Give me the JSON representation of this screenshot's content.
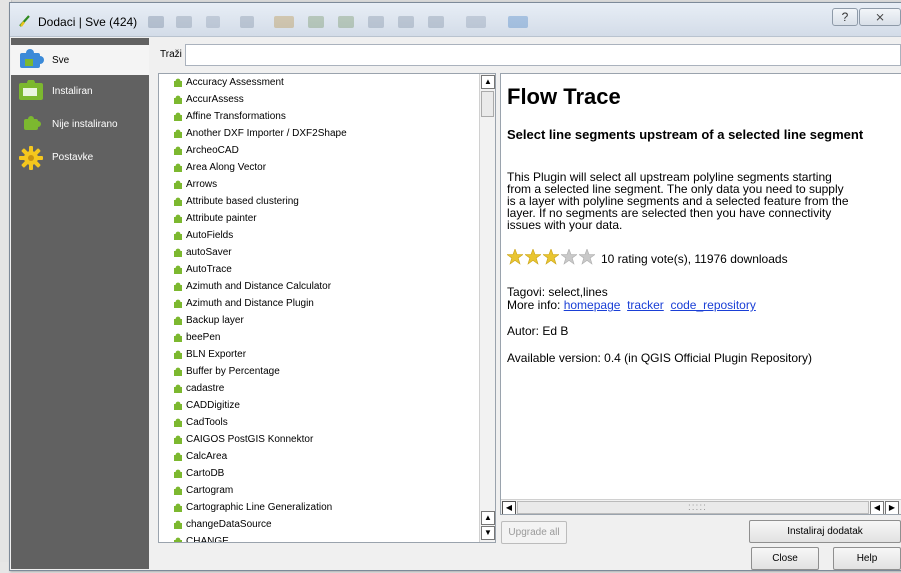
{
  "window": {
    "title": "Dodaci | Sve (424)",
    "controls": {
      "help": "?",
      "close": "⨯"
    }
  },
  "sidebar": {
    "items": [
      {
        "label": "Sve",
        "icon": "puzzle-blue-icon",
        "active": true
      },
      {
        "label": "Instaliran",
        "icon": "puzzle-green-icon",
        "active": false
      },
      {
        "label": "Nije instalirano",
        "icon": "puzzle-green-small-icon",
        "active": false
      },
      {
        "label": "Postavke",
        "icon": "gear-sun-icon",
        "active": false
      }
    ]
  },
  "search": {
    "label": "Traži",
    "value": ""
  },
  "plugin_list": {
    "items": [
      "Accuracy Assessment",
      "AccurAssess",
      "Affine Transformations",
      "Another DXF Importer / DXF2Shape",
      "ArcheoCAD",
      "Area Along Vector",
      "Arrows",
      "Attribute based clustering",
      "Attribute painter",
      "AutoFields",
      "autoSaver",
      "AutoTrace",
      "Azimuth and Distance Calculator",
      "Azimuth and Distance Plugin",
      "Backup layer",
      "beePen",
      "BLN Exporter",
      "Buffer by Percentage",
      "cadastre",
      "CADDigitize",
      "CadTools",
      "CAIGOS PostGIS Konnektor",
      "CalcArea",
      "CartoDB",
      "Cartogram",
      "Cartographic Line Generalization",
      "changeDataSource",
      "CHANGE"
    ]
  },
  "details": {
    "title": "Flow Trace",
    "subtitle": "Select line segments upstream of a selected line segment",
    "description_lines": [
      "This Plugin will select all upstream polyline segments starting",
      "from a selected line segment. The only data you need to supply",
      "is a layer with polyline segments and a selected feature from the",
      "layer. If no segments are selected then you have connectivity",
      "issues with your data."
    ],
    "rating_stars": 3,
    "rating_max": 5,
    "rating_text": "10 rating vote(s), 11976 downloads",
    "tags": "Tagovi: select,lines",
    "more_info_label": "More info:",
    "links": [
      "homepage",
      "tracker",
      "code_repository"
    ],
    "author": "Autor: Ed B",
    "version": "Available version: 0.4 (in QGIS Official Plugin Repository)"
  },
  "buttons": {
    "upgrade_all": "Upgrade all",
    "install": "Instaliraj dodatak",
    "close": "Close",
    "help": "Help"
  },
  "colors": {
    "sidebar_bg": "#616161",
    "link": "#1a3fd6",
    "star_filled": "#e9c531",
    "star_empty": "#c9c9c9",
    "puzzle_green": "#7cb82f"
  }
}
